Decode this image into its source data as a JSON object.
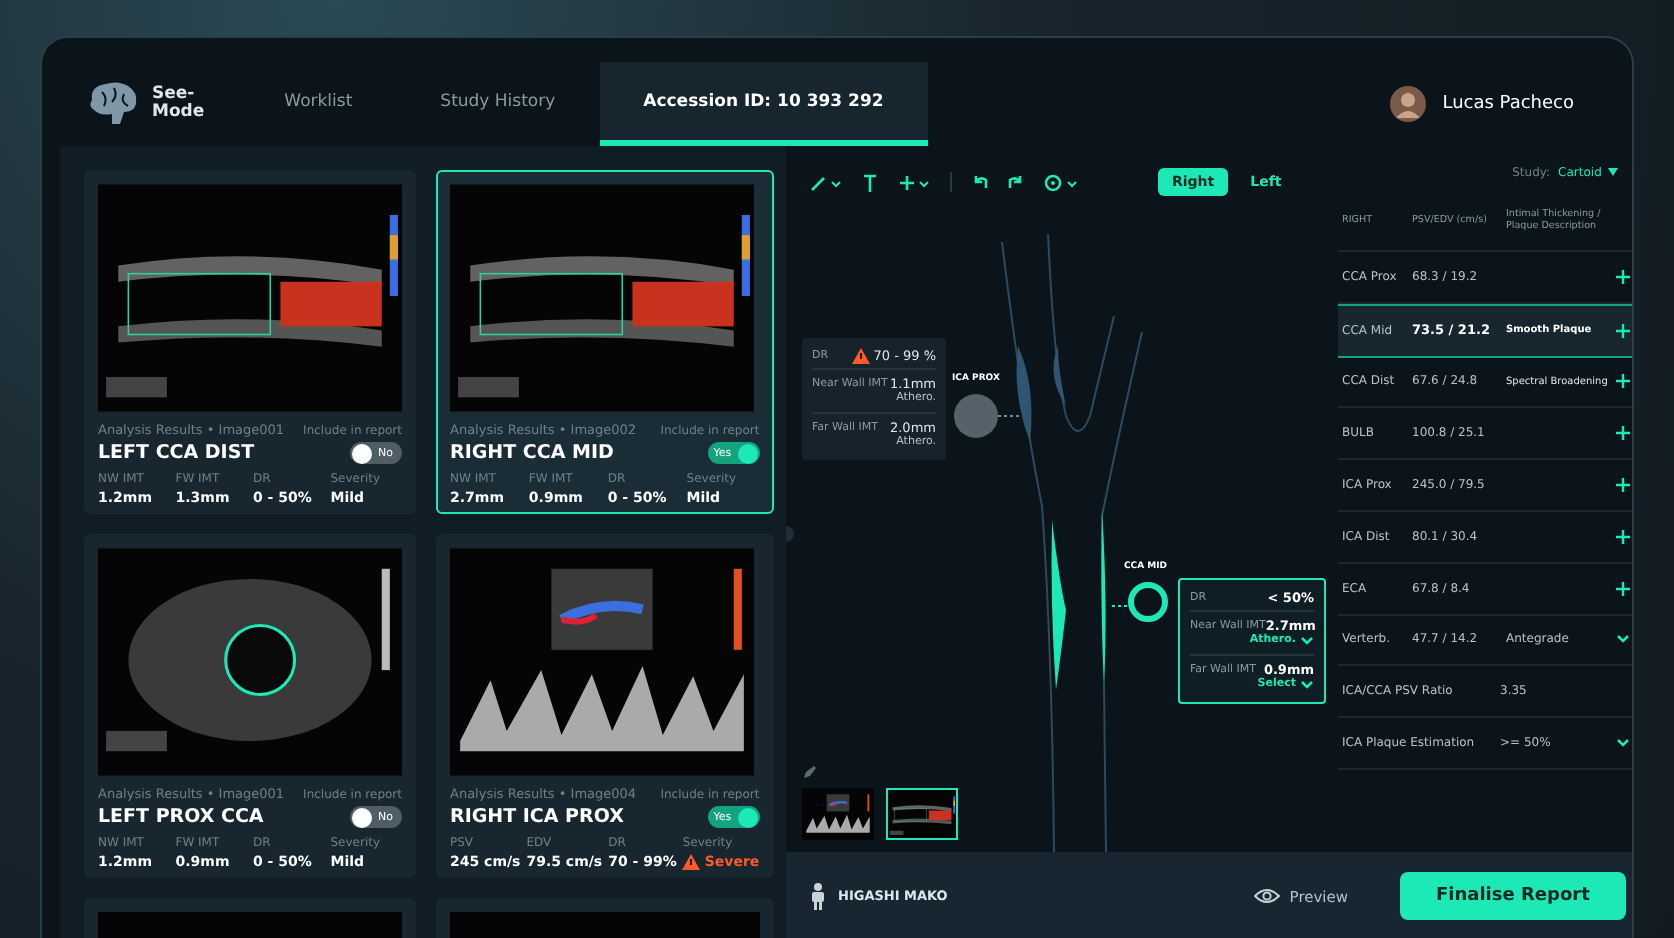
{
  "nav": {
    "logo_lines": [
      "See-",
      "Mode"
    ],
    "tabs": [
      {
        "label": "Worklist",
        "selected": false
      },
      {
        "label": "Study History",
        "selected": false
      },
      {
        "label": "Accession ID: 10 393 292",
        "selected": true
      }
    ],
    "user": {
      "name": "Lucas Pacheco"
    }
  },
  "cards": [
    {
      "kind": "color-doppler",
      "source": "Analysis Results",
      "separator": "•",
      "image": "Image001",
      "include_label": "Include in report",
      "title": "LEFT CCA DIST",
      "include": false,
      "toggle_label": "No",
      "selected": false,
      "metrics": [
        {
          "label": "NW IMT",
          "value": "1.2mm",
          "alert": false
        },
        {
          "label": "FW IMT",
          "value": "1.3mm",
          "alert": false
        },
        {
          "label": "DR",
          "value": "0 - 50%",
          "alert": false
        },
        {
          "label": "Severity",
          "value": "Mild",
          "alert": false
        }
      ]
    },
    {
      "kind": "color-doppler",
      "source": "Analysis Results",
      "separator": "•",
      "image": "Image002",
      "include_label": "Include in report",
      "title": "RIGHT CCA MID",
      "include": true,
      "toggle_label": "Yes",
      "selected": true,
      "metrics": [
        {
          "label": "NW IMT",
          "value": "2.7mm",
          "alert": false
        },
        {
          "label": "FW IMT",
          "value": "0.9mm",
          "alert": false
        },
        {
          "label": "DR",
          "value": "0 - 50%",
          "alert": false
        },
        {
          "label": "Severity",
          "value": "Mild",
          "alert": false
        }
      ]
    },
    {
      "kind": "cross-section",
      "source": "Analysis Results",
      "separator": "•",
      "image": "Image001",
      "include_label": "Include in report",
      "title": "LEFT PROX CCA",
      "include": false,
      "toggle_label": "No",
      "selected": false,
      "metrics": [
        {
          "label": "NW IMT",
          "value": "1.2mm",
          "alert": false
        },
        {
          "label": "FW IMT",
          "value": "0.9mm",
          "alert": false
        },
        {
          "label": "DR",
          "value": "0 - 50%",
          "alert": false
        },
        {
          "label": "Severity",
          "value": "Mild",
          "alert": false
        }
      ]
    },
    {
      "kind": "spectral",
      "source": "Analysis Results",
      "separator": "•",
      "image": "Image004",
      "include_label": "Include in report",
      "title": "RIGHT ICA PROX",
      "include": true,
      "toggle_label": "Yes",
      "selected": false,
      "metrics": [
        {
          "label": "PSV",
          "value": "245 cm/s",
          "alert": false
        },
        {
          "label": "EDV",
          "value": "79.5 cm/s",
          "alert": false
        },
        {
          "label": "DR",
          "value": "70 - 99%",
          "alert": false
        },
        {
          "label": "Severity",
          "value": "Severe",
          "alert": true
        }
      ]
    }
  ],
  "cut_cards": [
    {
      "selected": false
    },
    {
      "selected": false
    }
  ],
  "sides": [
    {
      "label": "Right",
      "selected": true
    },
    {
      "label": "Left",
      "selected": false
    }
  ],
  "study": {
    "label": "Study:",
    "value": "Cartoid"
  },
  "callouts": [
    {
      "node_label": "ICA PROX",
      "selected": false,
      "rows": [
        {
          "label": "DR",
          "value": "70 - 99 %",
          "alert": true,
          "note": null,
          "kind": "none"
        },
        {
          "label": "Near Wall IMT",
          "value": "1.1mm",
          "alert": false,
          "note": "Athero.",
          "kind": "text"
        },
        {
          "label": "Far Wall IMT",
          "value": "2.0mm",
          "alert": false,
          "note": "Athero.",
          "kind": "text"
        }
      ]
    },
    {
      "node_label": "CCA MID",
      "selected": true,
      "rows": [
        {
          "label": "DR",
          "value": "< 50%",
          "alert": false,
          "note": null,
          "kind": "none"
        },
        {
          "label": "Near Wall IMT",
          "value": "2.7mm",
          "alert": false,
          "note": "Athero.",
          "kind": "dropdown"
        },
        {
          "label": "Far Wall IMT",
          "value": "0.9mm",
          "alert": false,
          "note": "Select",
          "kind": "dropdown"
        }
      ]
    }
  ],
  "thumbnails": [
    {
      "kind": "spectral",
      "selected": false
    },
    {
      "kind": "color-doppler",
      "selected": true
    }
  ],
  "table": {
    "columns": [
      "RIGHT",
      "PSV/EDV (cm/s)",
      "Intimal Thickening / Plaque Description"
    ],
    "rows": [
      {
        "name": "CCA Prox",
        "value": "68.3 / 19.2",
        "description": null,
        "kind": "add",
        "selected": false
      },
      {
        "name": "CCA Mid",
        "value": "73.5 / 21.2",
        "description": "Smooth Plaque",
        "kind": "add",
        "selected": true
      },
      {
        "name": "CCA Dist",
        "value": "67.6 / 24.8",
        "description": "Spectral Broadening",
        "kind": "add",
        "selected": false
      },
      {
        "name": "BULB",
        "value": "100.8 / 25.1",
        "description": null,
        "kind": "add",
        "selected": false
      },
      {
        "name": "ICA Prox",
        "value": "245.0 / 79.5",
        "description": null,
        "kind": "add",
        "selected": false
      },
      {
        "name": "ICA Dist",
        "value": "80.1 / 30.4",
        "description": null,
        "kind": "add",
        "selected": false
      },
      {
        "name": "ECA",
        "value": "67.8 / 8.4",
        "description": null,
        "kind": "add",
        "selected": false
      },
      {
        "name": "Verterb.",
        "value": "47.7 / 14.2",
        "description": "Antegrade",
        "kind": "dropdown",
        "selected": false
      },
      {
        "name": "ICA/CCA PSV Ratio",
        "value": null,
        "description": "3.35",
        "kind": "none",
        "selected": false
      },
      {
        "name": "ICA Plaque Estimation",
        "value": null,
        "description": ">= 50%",
        "kind": "dropdown",
        "selected": false
      }
    ]
  },
  "footer": {
    "patient": "HIGASHI MAKO",
    "preview": "Preview",
    "finalise": "Finalise Report"
  }
}
